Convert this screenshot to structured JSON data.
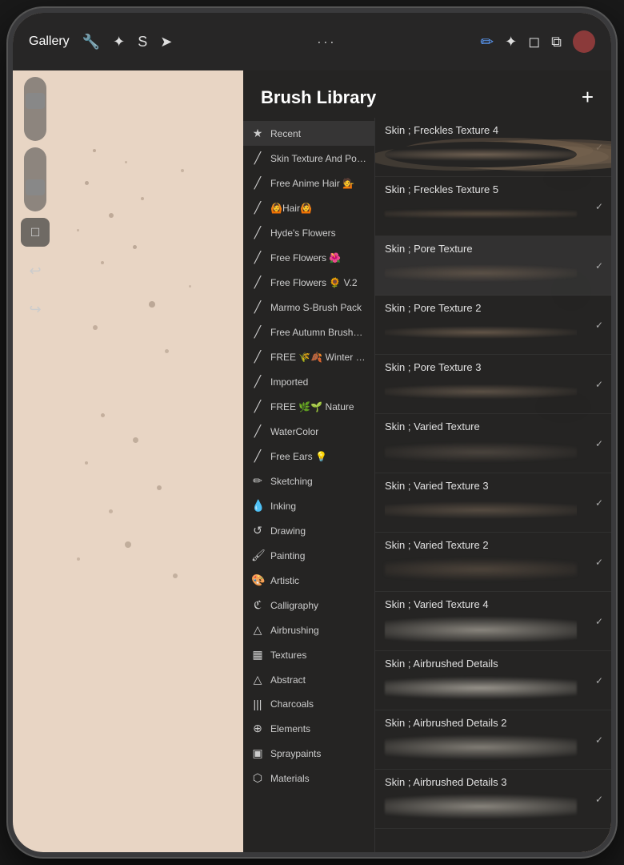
{
  "app": {
    "title": "Brush Library",
    "gallery_label": "Gallery"
  },
  "toolbar": {
    "plus_label": "+",
    "undo_label": "↩",
    "redo_label": "↪"
  },
  "sidebar": {
    "items": [
      {
        "id": "recent",
        "label": "Recent",
        "icon": "★",
        "active": true
      },
      {
        "id": "skin-texture-por",
        "label": "Skin Texture And Por...",
        "icon": "╱",
        "active": false
      },
      {
        "id": "free-anime-hair",
        "label": "Free Anime Hair 💁",
        "icon": "╱",
        "active": false
      },
      {
        "id": "hair",
        "label": "🙆Hair🙆",
        "icon": "╱",
        "active": false
      },
      {
        "id": "hydes-flowers",
        "label": "Hyde's Flowers",
        "icon": "╱",
        "active": false
      },
      {
        "id": "free-flowers",
        "label": "Free Flowers 🌺",
        "icon": "╱",
        "active": false
      },
      {
        "id": "free-flowers-v2",
        "label": "Free Flowers 🌻 V.2",
        "icon": "╱",
        "active": false
      },
      {
        "id": "marmo-s",
        "label": "Marmo S-Brush Pack",
        "icon": "╱",
        "active": false
      },
      {
        "id": "free-autumn",
        "label": "Free Autumn Brushe...",
        "icon": "╱",
        "active": false
      },
      {
        "id": "free-winter",
        "label": "FREE 🌾🍂 Winter N...",
        "icon": "╱",
        "active": false
      },
      {
        "id": "imported",
        "label": "Imported",
        "icon": "╱",
        "active": false
      },
      {
        "id": "free-nature",
        "label": "FREE 🌿🌱 Nature",
        "icon": "╱",
        "active": false
      },
      {
        "id": "watercolor",
        "label": "WaterColor",
        "icon": "╱",
        "active": false
      },
      {
        "id": "free-ears",
        "label": "Free Ears 💡",
        "icon": "╱",
        "active": false
      },
      {
        "id": "sketching",
        "label": "Sketching",
        "icon": "✏",
        "active": false
      },
      {
        "id": "inking",
        "label": "Inking",
        "icon": "💧",
        "active": false
      },
      {
        "id": "drawing",
        "label": "Drawing",
        "icon": "↺",
        "active": false
      },
      {
        "id": "painting",
        "label": "Painting",
        "icon": "🖌",
        "active": false
      },
      {
        "id": "artistic",
        "label": "Artistic",
        "icon": "🎨",
        "active": false
      },
      {
        "id": "calligraphy",
        "label": "Calligraphy",
        "icon": "ℭ",
        "active": false
      },
      {
        "id": "airbrushing",
        "label": "Airbrushing",
        "icon": "△",
        "active": false
      },
      {
        "id": "textures",
        "label": "Textures",
        "icon": "▦",
        "active": false
      },
      {
        "id": "abstract",
        "label": "Abstract",
        "icon": "△",
        "active": false
      },
      {
        "id": "charcoals",
        "label": "Charcoals",
        "icon": "|||",
        "active": false
      },
      {
        "id": "elements",
        "label": "Elements",
        "icon": "⊕",
        "active": false
      },
      {
        "id": "spraypaints",
        "label": "Spraypaints",
        "icon": "▣",
        "active": false
      },
      {
        "id": "materials",
        "label": "Materials",
        "icon": "⬡",
        "active": false
      }
    ]
  },
  "brushes": {
    "items": [
      {
        "id": "freckles4",
        "name": "Skin ; Freckles Texture 4",
        "selected": false,
        "stroke_class": "stroke-freckles4"
      },
      {
        "id": "freckles5",
        "name": "Skin ; Freckles Texture 5",
        "selected": false,
        "stroke_class": "stroke-freckles5"
      },
      {
        "id": "pore",
        "name": "Skin ; Pore Texture",
        "selected": true,
        "stroke_class": "stroke-pore"
      },
      {
        "id": "pore2",
        "name": "Skin ; Pore Texture 2",
        "selected": false,
        "stroke_class": "stroke-pore2"
      },
      {
        "id": "pore3",
        "name": "Skin ; Pore Texture 3",
        "selected": false,
        "stroke_class": "stroke-pore3"
      },
      {
        "id": "varied",
        "name": "Skin ; Varied Texture",
        "selected": false,
        "stroke_class": "stroke-varied"
      },
      {
        "id": "varied3",
        "name": "Skin ; Varied Texture 3",
        "selected": false,
        "stroke_class": "stroke-varied3"
      },
      {
        "id": "varied2",
        "name": "Skin ; Varied Texture 2",
        "selected": false,
        "stroke_class": "stroke-varied2"
      },
      {
        "id": "varied4",
        "name": "Skin ; Varied Texture 4",
        "selected": false,
        "stroke_class": "stroke-varied4"
      },
      {
        "id": "airbrushed",
        "name": "Skin ; Airbrushed Details",
        "selected": false,
        "stroke_class": "stroke-airbrushed"
      },
      {
        "id": "airbrushed2",
        "name": "Skin ; Airbrushed Details 2",
        "selected": false,
        "stroke_class": "stroke-airbrushed2"
      },
      {
        "id": "airbrushed3",
        "name": "Skin ; Airbrushed Details 3",
        "selected": false,
        "stroke_class": "stroke-airbrushed3"
      }
    ]
  }
}
